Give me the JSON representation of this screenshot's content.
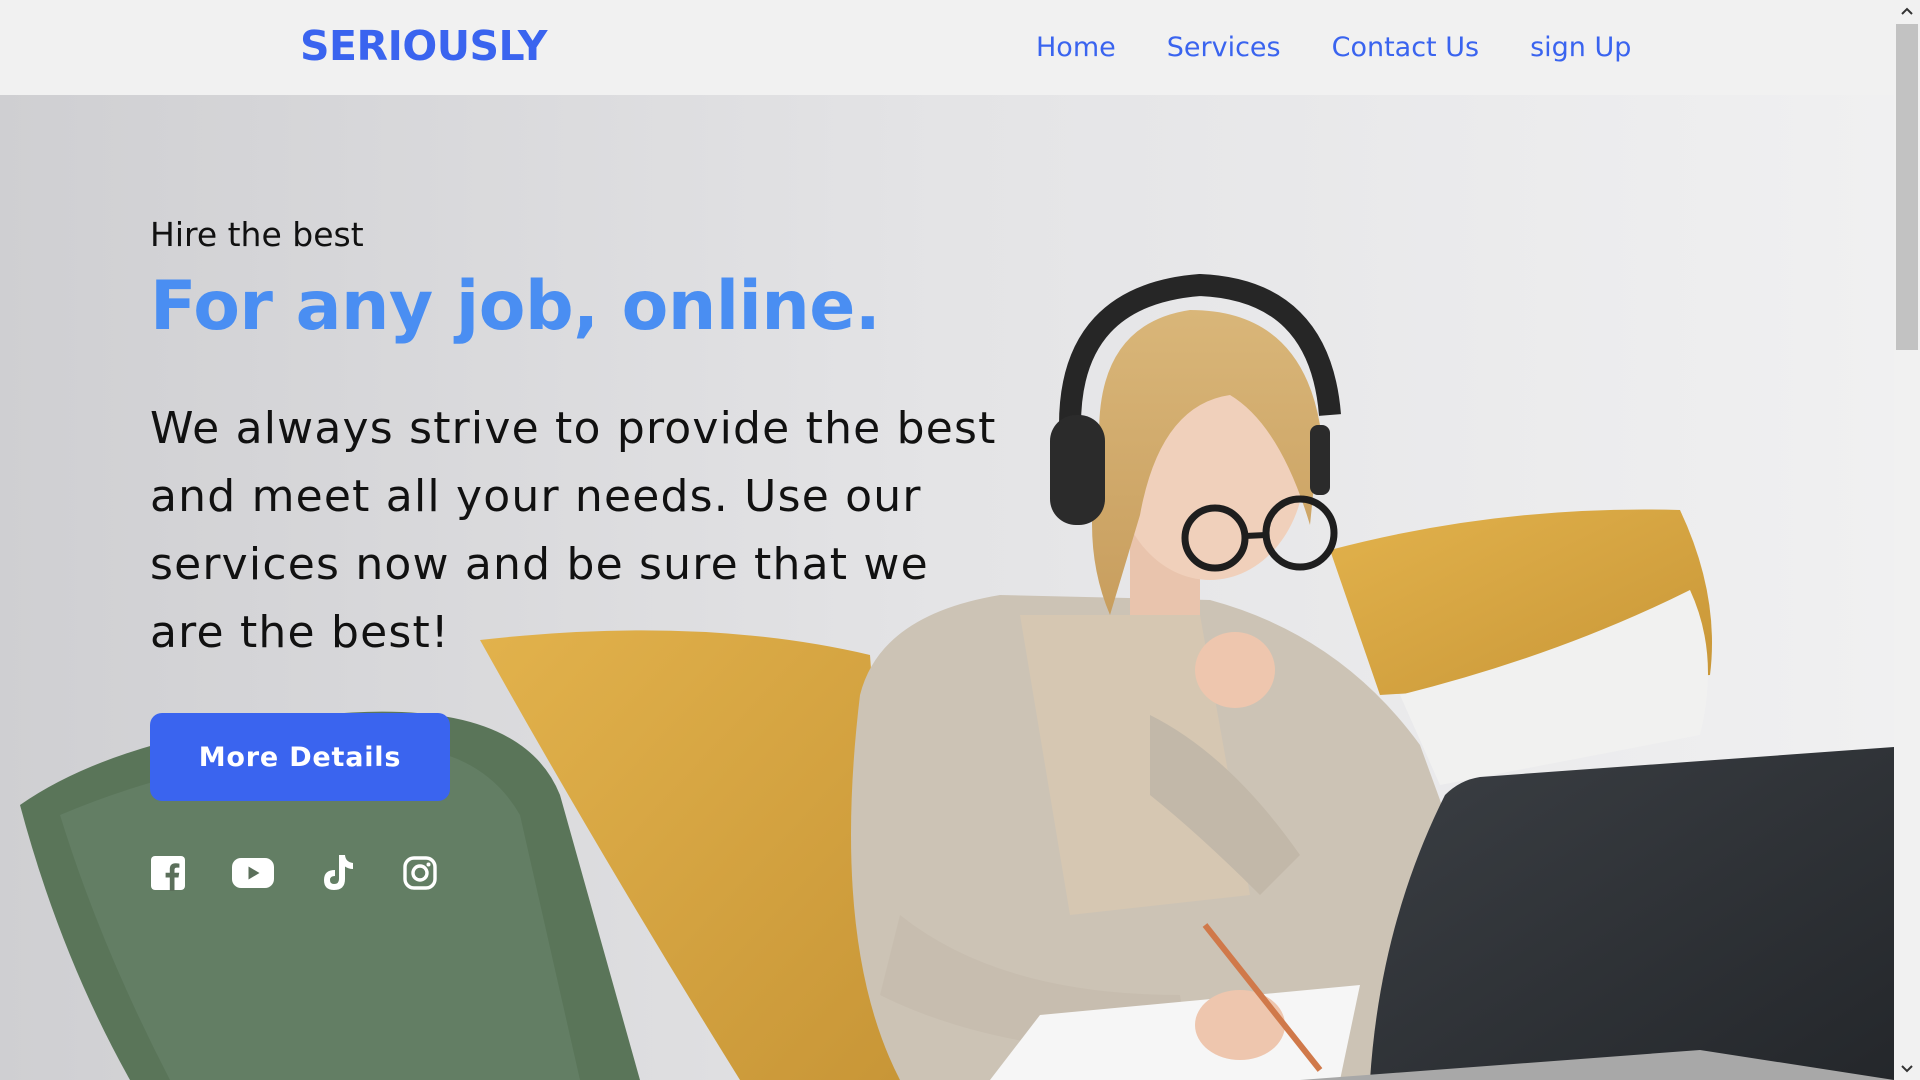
{
  "brand": {
    "logo": "SERIOUSLY",
    "color": "#3a64ef"
  },
  "nav": {
    "items": [
      {
        "label": "Home"
      },
      {
        "label": "Services"
      },
      {
        "label": "Contact Us"
      },
      {
        "label": "sign Up"
      }
    ]
  },
  "hero": {
    "kicker": "Hire the best",
    "headline": "For any job, online.",
    "headline_color": "#4a8ef2",
    "description": "We always strive to provide the best and meet all your needs. Use our services now and be sure that we are the best!",
    "cta_label": "More Details",
    "cta_color": "#3a64ef",
    "image_alt": "Woman with headphones and glasses writing in a notebook beside a laptop on a sofa"
  },
  "socials": [
    {
      "icon": "facebook-icon"
    },
    {
      "icon": "youtube-icon"
    },
    {
      "icon": "tiktok-icon"
    },
    {
      "icon": "instagram-icon"
    }
  ]
}
